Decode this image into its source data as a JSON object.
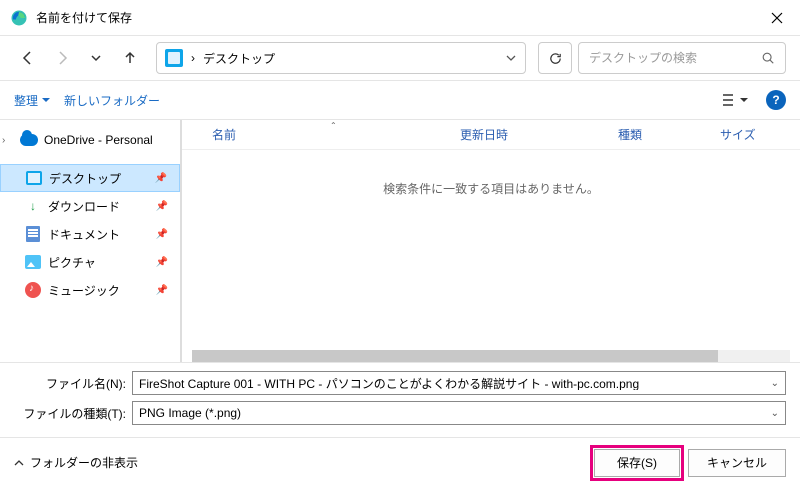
{
  "window": {
    "title": "名前を付けて保存"
  },
  "nav": {
    "location": "デスクトップ",
    "separator": "›"
  },
  "search": {
    "placeholder": "デスクトップの検索"
  },
  "toolbar": {
    "organize": "整理",
    "new_folder": "新しいフォルダー"
  },
  "tree": {
    "onedrive": "OneDrive - Personal",
    "items": [
      {
        "label": "デスクトップ"
      },
      {
        "label": "ダウンロード"
      },
      {
        "label": "ドキュメント"
      },
      {
        "label": "ピクチャ"
      },
      {
        "label": "ミュージック"
      }
    ]
  },
  "columns": {
    "name": "名前",
    "date": "更新日時",
    "type": "種類",
    "size": "サイズ"
  },
  "content": {
    "empty": "検索条件に一致する項目はありません。"
  },
  "fields": {
    "filename_label": "ファイル名(N):",
    "filename_value": "FireShot Capture 001 - WITH PC - パソコンのことがよくわかる解説サイト - with-pc.com.png",
    "filetype_label": "ファイルの種類(T):",
    "filetype_value": "PNG Image (*.png)"
  },
  "footer": {
    "hide_folders": "フォルダーの非表示",
    "save": "保存(S)",
    "cancel": "キャンセル"
  }
}
